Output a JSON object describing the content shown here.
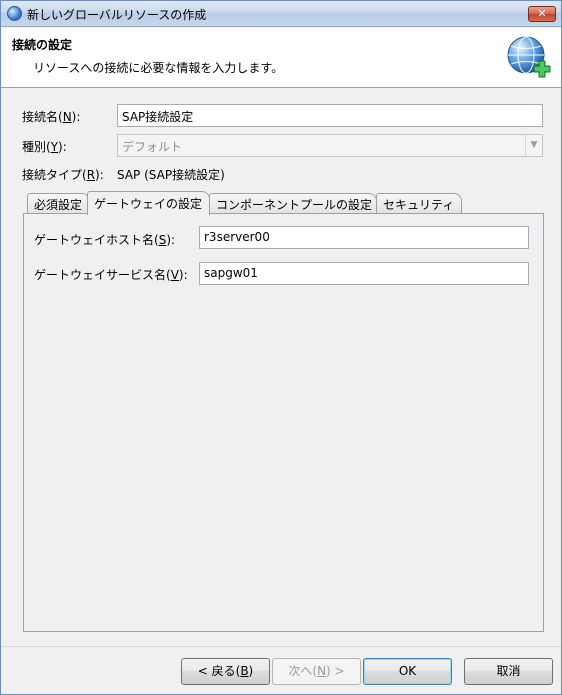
{
  "window": {
    "title": "新しいグローバルリソースの作成",
    "close_label": "✕"
  },
  "header": {
    "title": "接続の設定",
    "description": "リソースへの接続に必要な情報を入力します。",
    "icon": "globe-plus-icon"
  },
  "form": {
    "connection_name": {
      "label": "接続名(",
      "mnemonic": "N",
      "label_end": "):",
      "value": "SAP接続設定"
    },
    "type": {
      "label": "種別(",
      "mnemonic": "Y",
      "label_end": "):",
      "value": "デフォルト"
    },
    "connection_type": {
      "label": "接続タイプ(",
      "mnemonic": "R",
      "label_end": "):",
      "value": "SAP (SAP接続設定)"
    }
  },
  "tabs": [
    {
      "label": "必須設定"
    },
    {
      "label": "ゲートウェイの設定",
      "active": true
    },
    {
      "label": "コンポーネントプールの設定"
    },
    {
      "label": "セキュリティ"
    }
  ],
  "gateway": {
    "host": {
      "label": "ゲートウェイホスト名(",
      "mnemonic": "S",
      "label_end": "):",
      "value": "r3server00"
    },
    "service": {
      "label": "ゲートウェイサービス名(",
      "mnemonic": "V",
      "label_end": "):",
      "value": "sapgw01"
    }
  },
  "buttons": {
    "back": {
      "label": "< 戻る(",
      "mnemonic": "B",
      "label_end": ")"
    },
    "next": {
      "label": "次へ(",
      "mnemonic": "N",
      "label_end": ") >"
    },
    "ok": "OK",
    "cancel": "取消"
  }
}
